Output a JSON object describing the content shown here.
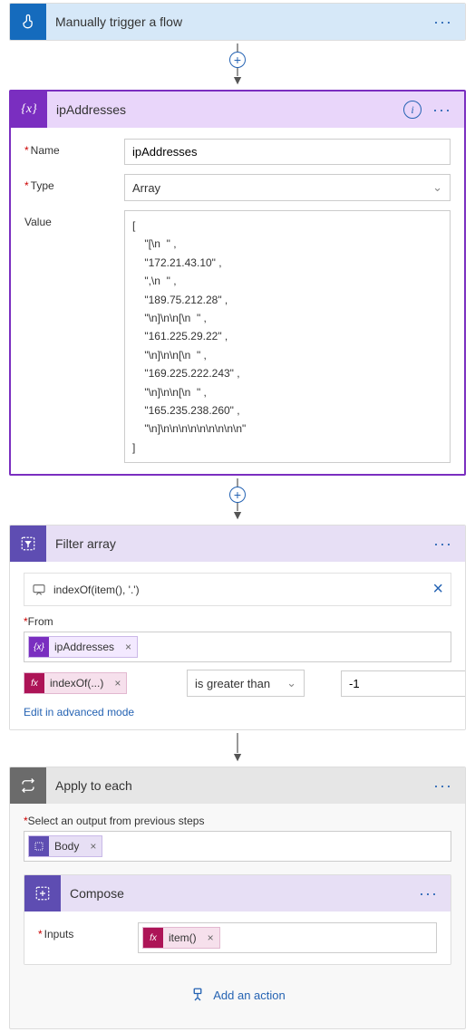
{
  "trigger": {
    "title": "Manually trigger a flow"
  },
  "variable": {
    "title": "ipAddresses",
    "labels": {
      "name": "Name",
      "type": "Type",
      "value": "Value"
    },
    "name": "ipAddresses",
    "type": "Array",
    "value": "[\n    \"[\\n  \" ,\n    \"172.21.43.10\" ,\n    \",\\n  \" ,\n    \"189.75.212.28\" ,\n    \"\\n]\\n\\n[\\n  \" ,\n    \"161.225.29.22\" ,\n    \"\\n]\\n\\n[\\n  \" ,\n    \"169.225.222.243\" ,\n    \"\\n]\\n\\n[\\n  \" ,\n    \"165.235.238.260\" ,\n    \"\\n]\\n\\n\\n\\n\\n\\n\\n\\n\\n\"\n]"
  },
  "filter": {
    "title": "Filter array",
    "expression": "indexOf(item(), '.')",
    "from_label": "From",
    "from_token": "ipAddresses",
    "fx_token": "indexOf(...)",
    "operator": "is greater than",
    "value": "-1",
    "adv_link": "Edit in advanced mode"
  },
  "apply": {
    "title": "Apply to each",
    "select_label": "Select an output from previous steps",
    "body_token": "Body"
  },
  "compose": {
    "title": "Compose",
    "inputs_label": "Inputs",
    "fx_token": "item()"
  },
  "add_action": "Add an action"
}
